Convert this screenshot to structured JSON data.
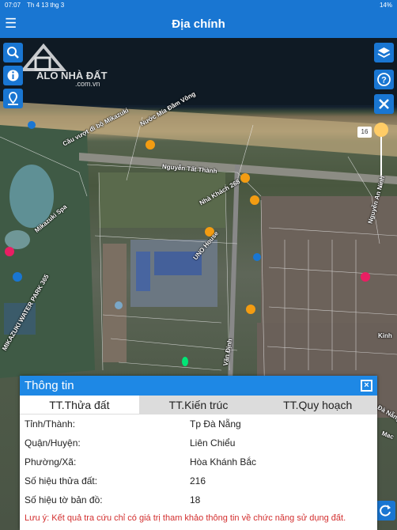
{
  "status": {
    "time": "07:07",
    "date": "Th 4 13 thg 3",
    "battery": "14%"
  },
  "appbar": {
    "title": "Địa chính"
  },
  "watermark": {
    "text": "ALO NHÀ ĐẤT",
    "sub": ".com.vn"
  },
  "map": {
    "labels": [
      "Nước Mía Đầm Vông",
      "Cầu vượt đi bộ Mikazuki",
      "Nguyễn Tất Thành",
      "Nhà Khách 268",
      "UNO House",
      "Nguyễn An Ninh",
      "Kinh",
      "Văn Định",
      "MIKAZUKI WATER PARK 365",
      "Mikazuki Spa",
      "Đà Nẵng",
      "Mac"
    ],
    "zoom_value": "16"
  },
  "panel": {
    "title": "Thông tin",
    "tabs": [
      "TT.Thửa đất",
      "TT.Kiến trúc",
      "TT.Quy hoạch"
    ],
    "rows": [
      {
        "key": "Tỉnh/Thành:",
        "value": "Tp Đà Nẵng"
      },
      {
        "key": "Quận/Huyện:",
        "value": "Liên Chiểu"
      },
      {
        "key": "Phường/Xã:",
        "value": "Hòa Khánh Bắc"
      },
      {
        "key": "Số hiệu thửa đất:",
        "value": "216"
      },
      {
        "key": "Số hiệu tờ bản đồ:",
        "value": "18"
      }
    ],
    "note": "Lưu ý: Kết quả tra cứu chỉ có giá trị tham khảo thông tin về chức năng sử dụng đất."
  },
  "colors": {
    "primary": "#1976d2",
    "note": "#d32f2f",
    "marker": "#f39c12",
    "parcel": "#00e676"
  },
  "icons": [
    "menu-icon",
    "search-icon",
    "info-icon",
    "location-icon",
    "layers-icon",
    "help-icon",
    "tools-icon",
    "refresh-icon",
    "close-icon"
  ]
}
